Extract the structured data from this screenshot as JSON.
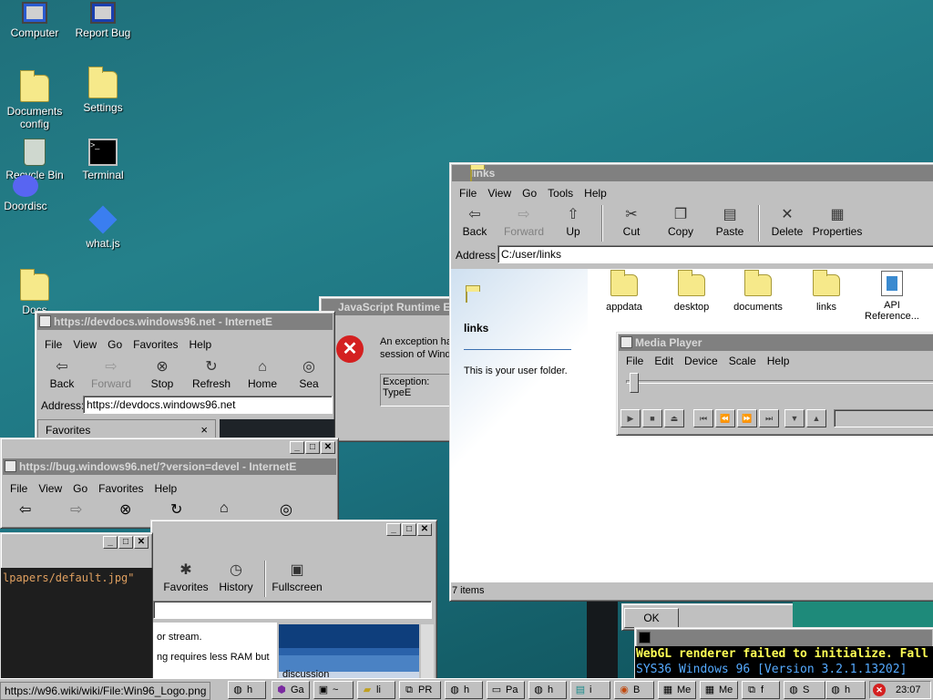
{
  "desktop_icons": [
    {
      "label": "Computer"
    },
    {
      "label": "Report Bug"
    },
    {
      "label": "Documents config"
    },
    {
      "label": "Settings"
    },
    {
      "label": "Recycle Bin"
    },
    {
      "label": "Terminal"
    },
    {
      "label": "Doordisc"
    },
    {
      "label": "what.js"
    },
    {
      "label": "Docs"
    }
  ],
  "explorer": {
    "title": "links",
    "menu": [
      "File",
      "View",
      "Go",
      "Tools",
      "Help"
    ],
    "toolbar": {
      "back": "Back",
      "forward": "Forward",
      "up": "Up",
      "cut": "Cut",
      "copy": "Copy",
      "paste": "Paste",
      "delete": "Delete",
      "properties": "Properties"
    },
    "address_label": "Address",
    "address_value": "C:/user/links",
    "folder_name": "links",
    "folder_desc": "This is your user folder.",
    "items": [
      {
        "name": "appdata"
      },
      {
        "name": "desktop"
      },
      {
        "name": "documents"
      },
      {
        "name": "links"
      },
      {
        "name": "API Reference..."
      }
    ],
    "status": "7 items"
  },
  "media_player": {
    "title": "Media Player",
    "menu": [
      "File",
      "Edit",
      "Device",
      "Scale",
      "Help"
    ]
  },
  "js_error": {
    "title": "JavaScript Runtime Error",
    "message": "An exception ha session of Wind",
    "detail": "Exception: TypeE",
    "ok": "OK"
  },
  "browser1": {
    "title": "https://devdocs.windows96.net - InternetE",
    "menu": [
      "File",
      "View",
      "Go",
      "Favorites",
      "Help"
    ],
    "toolbar": {
      "back": "Back",
      "forward": "Forward",
      "stop": "Stop",
      "refresh": "Refresh",
      "home": "Home",
      "search": "Sea"
    },
    "address_label": "Address:",
    "address_value": "https://devdocs.windows96.net",
    "favorites": "Favorites",
    "favorites_close": "×"
  },
  "browser2": {
    "title": "https://bug.windows96.net/?version=devel - InternetE",
    "menu": [
      "File",
      "View",
      "Go",
      "Favorites",
      "Help"
    ]
  },
  "browser3": {
    "toolbar": {
      "favorites": "Favorites",
      "history": "History",
      "fullscreen": "Fullscreen"
    },
    "text1": "or stream.",
    "text2": "ng requires less RAM but",
    "list_item": "discussion"
  },
  "editor": {
    "code": "lpapers/default.jpg\""
  },
  "terminal": {
    "line1": "WebGL renderer failed to initialize. Fall",
    "line2": "SYS36 Windows 96 [Version 3.2.1.13202]"
  },
  "status_link": "https://w96.wiki/wiki/File:Win96_Logo.png",
  "taskbar": {
    "items": [
      "h",
      "Ga",
      "~",
      "li",
      "PR",
      "h",
      "Pa",
      "h",
      "i",
      "B",
      "Me",
      "Me",
      "f",
      "h",
      "S",
      "h"
    ],
    "clock": "23:07"
  }
}
